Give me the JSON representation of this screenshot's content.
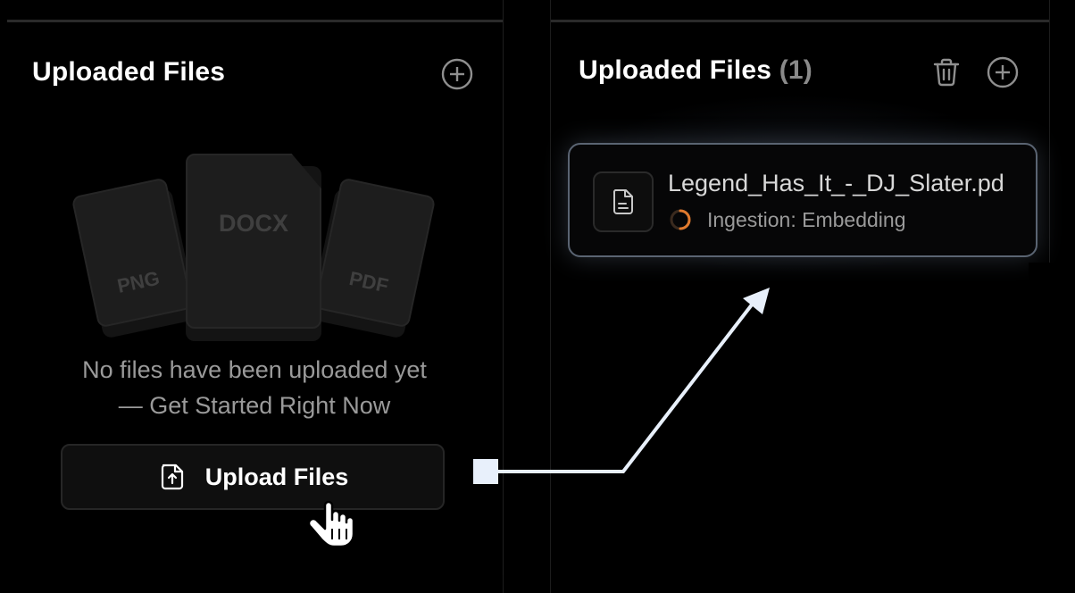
{
  "left_panel": {
    "title": "Uploaded Files",
    "add_icon": "plus-circle-icon",
    "illustration": {
      "left_doc_label": "PNG",
      "center_doc_label": "DOCX",
      "right_doc_label": "PDF"
    },
    "empty_line1": "No files have been uploaded yet",
    "empty_line2": "— Get Started Right Now",
    "upload_button_label": "Upload Files",
    "upload_icon": "file-upload-icon"
  },
  "right_panel": {
    "title": "Uploaded Files",
    "count": "(1)",
    "delete_icon": "trash-icon",
    "add_icon": "plus-circle-icon",
    "files": [
      {
        "name": "Legend_Has_It_-_DJ_Slater.pd",
        "status": "Ingestion: Embedding",
        "icon": "document-icon"
      }
    ]
  },
  "colors": {
    "background": "#000000",
    "spinner_accent": "#e07a2e",
    "arrow": "#e8f0fb",
    "card_border": "#5a6472"
  }
}
